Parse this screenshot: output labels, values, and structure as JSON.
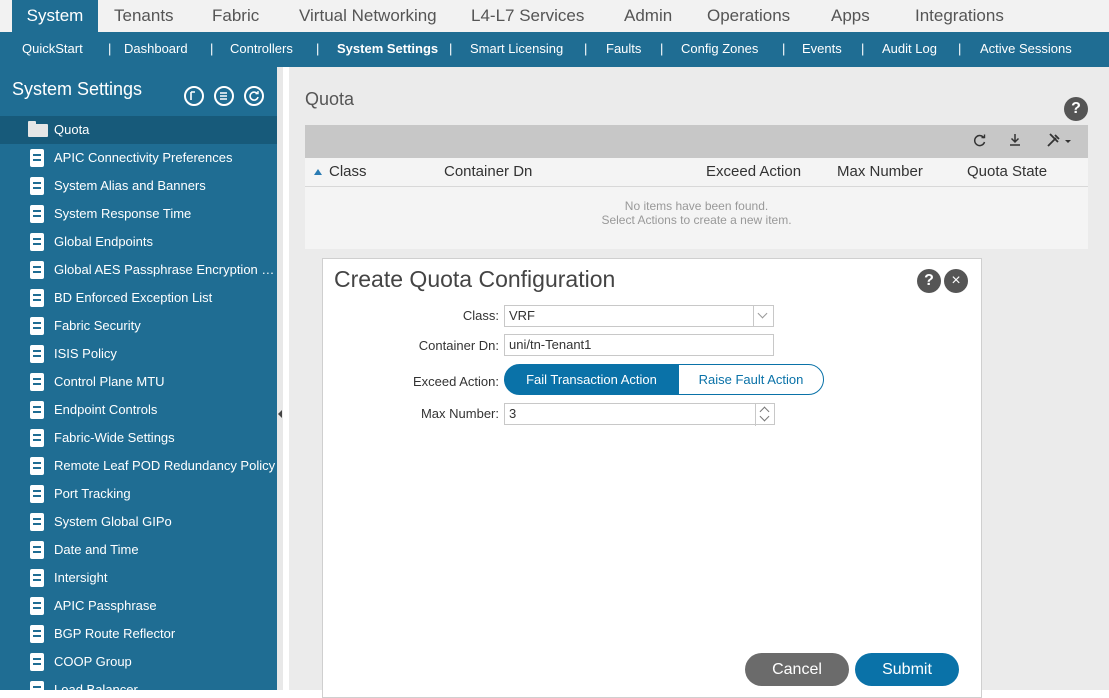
{
  "topnav": {
    "tabs": [
      {
        "label": "System"
      },
      {
        "label": "Tenants"
      },
      {
        "label": "Fabric"
      },
      {
        "label": "Virtual Networking"
      },
      {
        "label": "L4-L7 Services"
      },
      {
        "label": "Admin"
      },
      {
        "label": "Operations"
      },
      {
        "label": "Apps"
      },
      {
        "label": "Integrations"
      }
    ],
    "active": "System"
  },
  "subnav": {
    "items": [
      {
        "label": "QuickStart"
      },
      {
        "label": "Dashboard"
      },
      {
        "label": "Controllers"
      },
      {
        "label": "System Settings"
      },
      {
        "label": "Smart Licensing"
      },
      {
        "label": "Faults"
      },
      {
        "label": "Config Zones"
      },
      {
        "label": "Events"
      },
      {
        "label": "Audit Log"
      },
      {
        "label": "Active Sessions"
      }
    ],
    "separator": "|",
    "active": "System Settings"
  },
  "sidebar": {
    "title": "System Settings",
    "header_icons": [
      "collapse-icon",
      "list-icon",
      "refresh-icon"
    ],
    "items": [
      {
        "label": "Quota",
        "icon": "folder-icon"
      },
      {
        "label": "APIC Connectivity Preferences",
        "icon": "document-icon"
      },
      {
        "label": "System Alias and Banners",
        "icon": "document-icon"
      },
      {
        "label": "System Response Time",
        "icon": "document-icon"
      },
      {
        "label": "Global Endpoints",
        "icon": "document-icon"
      },
      {
        "label": "Global AES Passphrase Encryption Settings",
        "icon": "document-icon"
      },
      {
        "label": "BD Enforced Exception List",
        "icon": "document-icon"
      },
      {
        "label": "Fabric Security",
        "icon": "document-icon"
      },
      {
        "label": "ISIS Policy",
        "icon": "document-icon"
      },
      {
        "label": "Control Plane MTU",
        "icon": "document-icon"
      },
      {
        "label": "Endpoint Controls",
        "icon": "document-icon"
      },
      {
        "label": "Fabric-Wide Settings",
        "icon": "document-icon"
      },
      {
        "label": "Remote Leaf POD Redundancy Policy",
        "icon": "document-icon"
      },
      {
        "label": "Port Tracking",
        "icon": "document-icon"
      },
      {
        "label": "System Global GIPo",
        "icon": "document-icon"
      },
      {
        "label": "Date and Time",
        "icon": "document-icon"
      },
      {
        "label": "Intersight",
        "icon": "document-icon"
      },
      {
        "label": "APIC Passphrase",
        "icon": "document-icon"
      },
      {
        "label": "BGP Route Reflector",
        "icon": "document-icon"
      },
      {
        "label": "COOP Group",
        "icon": "document-icon"
      },
      {
        "label": "Load Balancer",
        "icon": "document-icon"
      }
    ],
    "selected": "Quota"
  },
  "main": {
    "title": "Quota",
    "help_icon": "?",
    "toolbar_icons": [
      "refresh-icon",
      "download-icon",
      "tools-icon"
    ],
    "table": {
      "columns": [
        "Class",
        "Container Dn",
        "Exceed Action",
        "Max Number",
        "Quota State"
      ],
      "sort_column": "Class",
      "empty_line1": "No items have been found.",
      "empty_line2": "Select Actions to create a new item."
    }
  },
  "dialog": {
    "title": "Create Quota Configuration",
    "help_icon": "?",
    "close_icon": "×",
    "class_label": "Class:",
    "class_value": "VRF",
    "container_dn_label": "Container Dn:",
    "container_dn_value": "uni/tn-Tenant1",
    "exceed_action_label": "Exceed Action:",
    "exceed_options": [
      "Fail Transaction Action",
      "Raise Fault Action"
    ],
    "exceed_selected": "Fail Transaction Action",
    "max_number_label": "Max Number:",
    "max_number_value": "3",
    "cancel_label": "Cancel",
    "submit_label": "Submit"
  },
  "colors": {
    "brand": "#1f6d93",
    "accent": "#0a72a8",
    "cancel": "#6b6b6b"
  }
}
